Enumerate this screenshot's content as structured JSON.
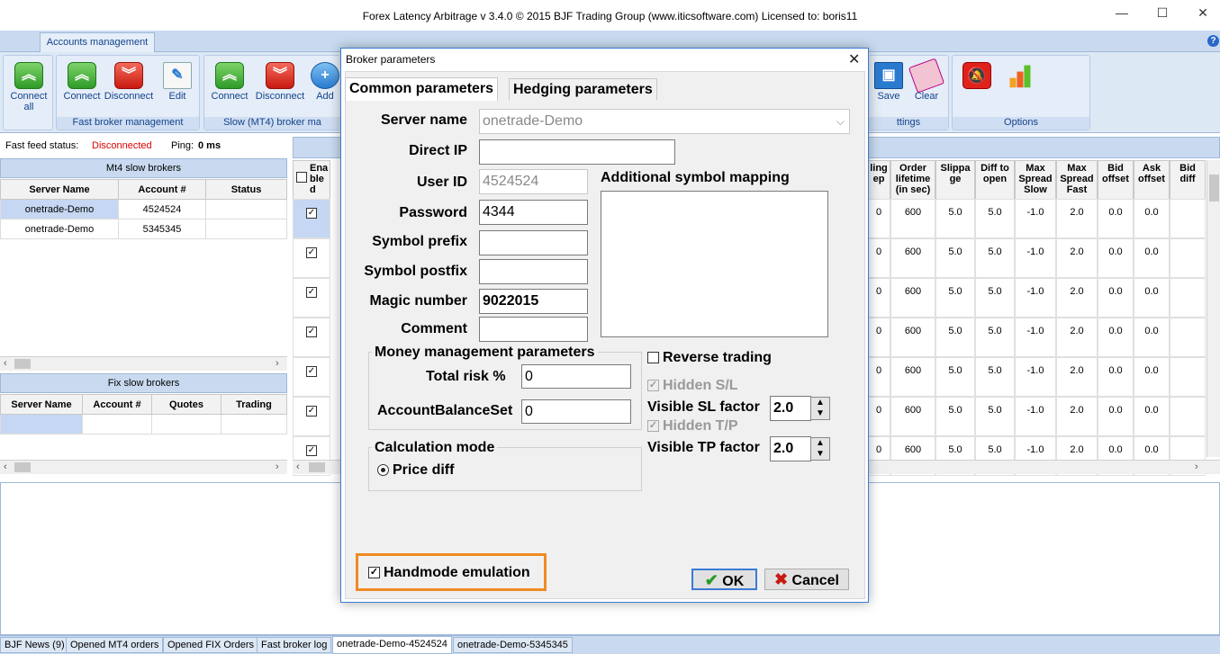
{
  "window": {
    "title": "Forex Latency Arbitrage v 3.4.0 © 2015 BJF Trading Group (www.iticsoftware.com) Licensed to: boris11",
    "minimize": "—",
    "maximize": "☐",
    "close": "✕"
  },
  "ribbon": {
    "tab": "Accounts management",
    "help": "?",
    "groups": {
      "connect_all": {
        "label": "Connect\nall"
      },
      "fast": {
        "title": "Fast broker management",
        "connect": "Connect",
        "disconnect": "Disconnect",
        "edit": "Edit"
      },
      "slow": {
        "title": "Slow (MT4)  broker ma",
        "connect": "Connect",
        "disconnect": "Disconnect",
        "add": "Add"
      },
      "settings": {
        "title": "ttings",
        "save": "Save",
        "clear": "Clear"
      },
      "options": {
        "title": "Options"
      }
    }
  },
  "status": {
    "fast_feed_label": "Fast feed status:",
    "fast_feed_value": "Disconnected",
    "ping_label": "Ping:",
    "ping_value": "0 ms"
  },
  "mt4_panel": {
    "title": "Mt4 slow brokers",
    "columns": [
      "Server Name",
      "Account #",
      "Status"
    ],
    "rows": [
      {
        "server": "onetrade-Demo",
        "account": "4524524",
        "status": ""
      },
      {
        "server": "onetrade-Demo",
        "account": "5345345",
        "status": ""
      }
    ]
  },
  "fix_panel": {
    "title": "Fix slow brokers",
    "columns": [
      "Server Name",
      "Account #",
      "Quotes",
      "Trading"
    ]
  },
  "right_grid": {
    "enabled_header": "Ena\nble\nd",
    "columns": [
      "ling\nep",
      "Order\nlifetime\n(in sec)",
      "Slippa\nge",
      "Diff to\nopen",
      "Max\nSpread\nSlow",
      "Max\nSpread\nFast",
      "Bid\noffset",
      "Ask\noffset",
      "Bid\ndiff"
    ],
    "rows": [
      [
        "0",
        "600",
        "5.0",
        "5.0",
        "-1.0",
        "2.0",
        "0.0",
        "0.0",
        ""
      ],
      [
        "0",
        "600",
        "5.0",
        "5.0",
        "-1.0",
        "2.0",
        "0.0",
        "0.0",
        ""
      ],
      [
        "0",
        "600",
        "5.0",
        "5.0",
        "-1.0",
        "2.0",
        "0.0",
        "0.0",
        ""
      ],
      [
        "0",
        "600",
        "5.0",
        "5.0",
        "-1.0",
        "2.0",
        "0.0",
        "0.0",
        ""
      ],
      [
        "0",
        "600",
        "5.0",
        "5.0",
        "-1.0",
        "2.0",
        "0.0",
        "0.0",
        ""
      ],
      [
        "0",
        "600",
        "5.0",
        "5.0",
        "-1.0",
        "2.0",
        "0.0",
        "0.0",
        ""
      ],
      [
        "0",
        "600",
        "5.0",
        "5.0",
        "-1.0",
        "2.0",
        "0.0",
        "0.0",
        ""
      ]
    ]
  },
  "bottom_tabs": [
    "BJF News (9)",
    "Opened MT4 orders",
    "Opened FIX Orders",
    "Fast broker log",
    "onetrade-Demo-4524524",
    "onetrade-Demo-5345345"
  ],
  "dialog": {
    "title": "Broker parameters",
    "close": "✕",
    "tabs": [
      "Common parameters",
      "Hedging parameters"
    ],
    "server_name_label": "Server name",
    "server_name_value": "onetrade-Demo",
    "direct_ip_label": "Direct IP",
    "direct_ip_value": "",
    "user_id_label": "User ID",
    "user_id_value": "4524524",
    "password_label": "Password",
    "password_value": "4344",
    "symbol_prefix_label": "Symbol prefix",
    "symbol_prefix_value": "",
    "symbol_postfix_label": "Symbol postfix",
    "symbol_postfix_value": "",
    "magic_label": "Magic number",
    "magic_value": "9022015",
    "comment_label": "Comment",
    "comment_value": "",
    "mapping_label": "Additional symbol mapping",
    "mm_legend": "Money management parameters",
    "total_risk_label": "Total risk %",
    "total_risk_value": "0",
    "balance_label": "AccountBalanceSet",
    "balance_value": "0",
    "calc_legend": "Calculation mode",
    "calc_option": "Price diff",
    "reverse_label": "Reverse trading",
    "hidden_sl_label": "Hidden S/L",
    "visible_sl_label": "Visible SL factor",
    "visible_sl_value": "2.0",
    "hidden_tp_label": "Hidden T/P",
    "visible_tp_label": "Visible TP factor",
    "visible_tp_value": "2.0",
    "handmode_label": "Handmode emulation",
    "ok_label": "OK",
    "cancel_label": "Cancel"
  },
  "colors": {
    "accent": "#3a7bd5",
    "ribbon_bg": "#dde8f5",
    "disconnected": "#e00000",
    "highlight": "#f08a24"
  }
}
